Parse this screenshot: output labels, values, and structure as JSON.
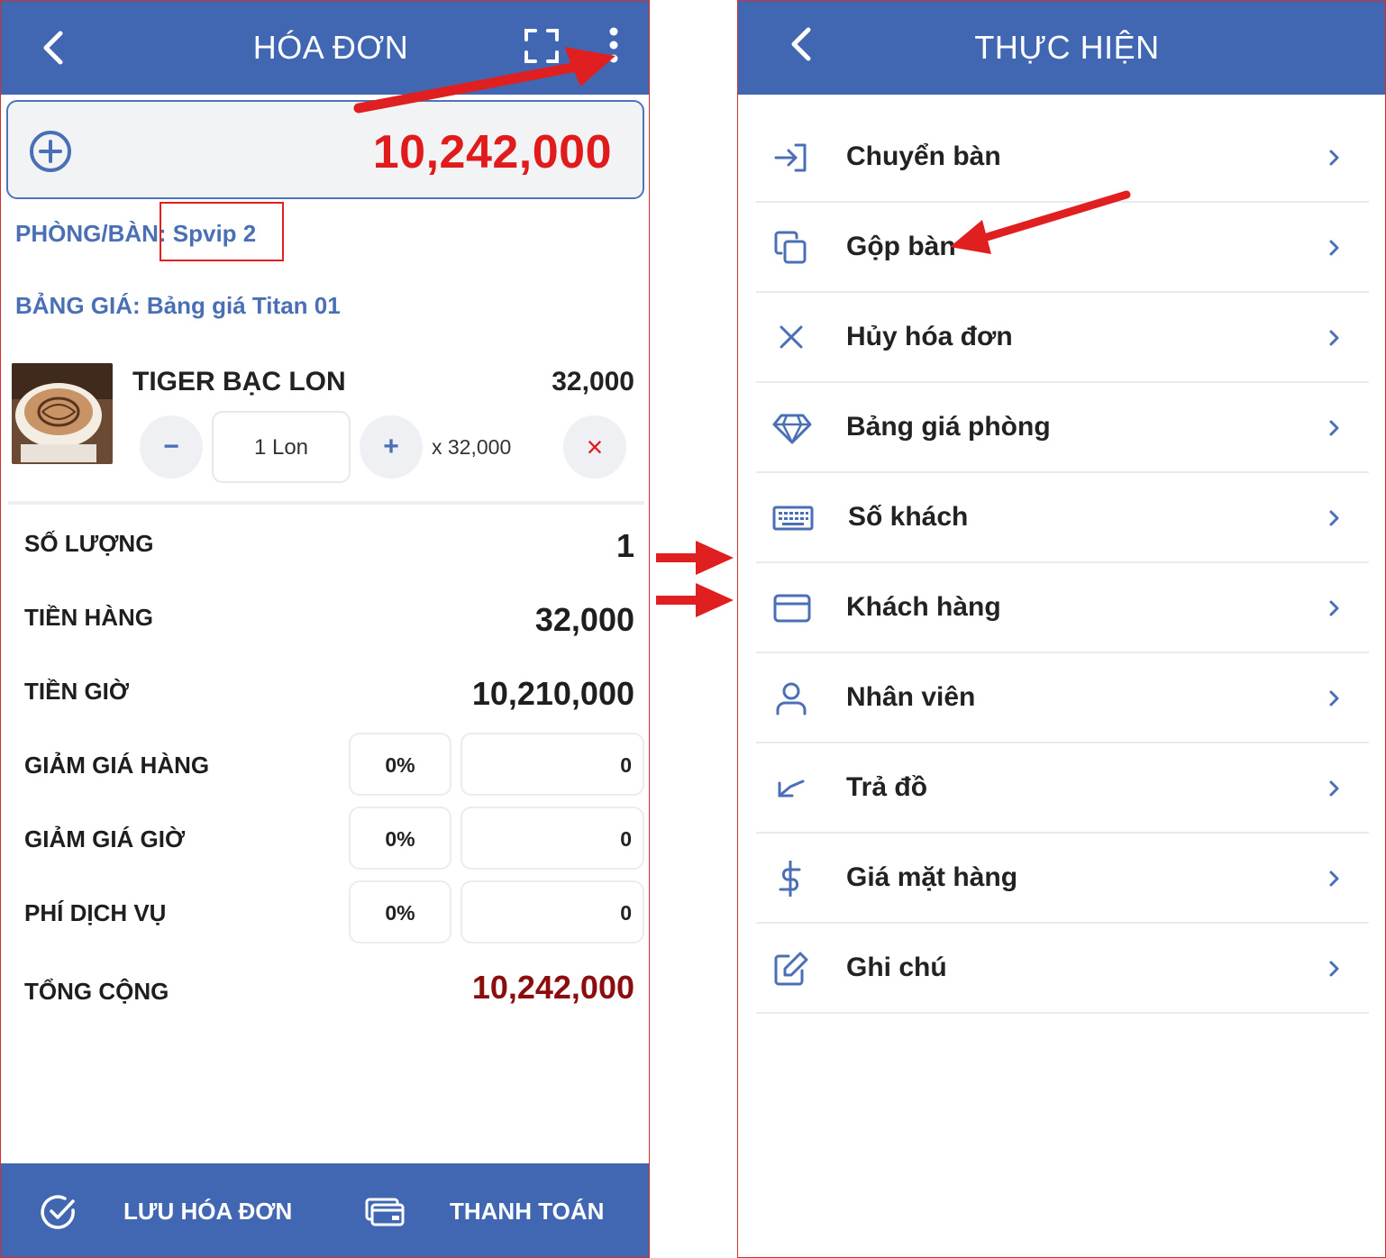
{
  "invoice": {
    "title": "HÓA ĐƠN",
    "total_amount": "10,242,000",
    "room_line": "PHÒNG/BÀN: Spvip 2",
    "price_list_line": "BẢNG GIÁ: Bảng giá Titan 01",
    "item": {
      "name": "TIGER BẠC LON",
      "price": "32,000",
      "minus": "−",
      "quantity": "1 Lon",
      "plus": "+",
      "unit_price": "x 32,000",
      "remove": "×"
    },
    "summary": {
      "quantity_label": "SỐ LƯỢNG",
      "quantity_value": "1",
      "goods_label": "TIỀN HÀNG",
      "goods_value": "32,000",
      "hours_label": "TIỀN GIỜ",
      "hours_value": "10,210,000",
      "goods_discount_label": "GIẢM GIÁ HÀNG",
      "goods_discount_pct": "0%",
      "goods_discount_amt": "0",
      "hours_discount_label": "GIẢM GIÁ GIỜ",
      "hours_discount_pct": "0%",
      "hours_discount_amt": "0",
      "service_fee_label": "PHÍ DỊCH VỤ",
      "service_fee_pct": "0%",
      "service_fee_amt": "0",
      "grand_total_label": "TỔNG CỘNG",
      "grand_total_value": "10,242,000"
    },
    "bottom": {
      "save_label": "LƯU HÓA ĐƠN",
      "pay_label": "THANH TOÁN"
    }
  },
  "actions": {
    "title": "THỰC HIỆN",
    "items": [
      {
        "label": "Chuyển bàn",
        "icon": "login-arrow-icon"
      },
      {
        "label": "Gộp bàn",
        "icon": "copy-icon"
      },
      {
        "label": "Hủy hóa đơn",
        "icon": "close-x-icon"
      },
      {
        "label": "Bảng giá phòng",
        "icon": "diamond-icon"
      },
      {
        "label": "Số khách",
        "icon": "keyboard-icon"
      },
      {
        "label": "Khách hàng",
        "icon": "credit-card-icon"
      },
      {
        "label": "Nhân viên",
        "icon": "user-icon"
      },
      {
        "label": "Trả đồ",
        "icon": "return-arrow-icon"
      },
      {
        "label": "Giá mặt hàng",
        "icon": "dollar-icon"
      },
      {
        "label": "Ghi chú",
        "icon": "edit-note-icon"
      }
    ]
  },
  "colors": {
    "primary": "#4267b2",
    "total_red": "#e11b1b",
    "grand_total": "#8b0d0d",
    "annotation_red": "#e02020"
  }
}
